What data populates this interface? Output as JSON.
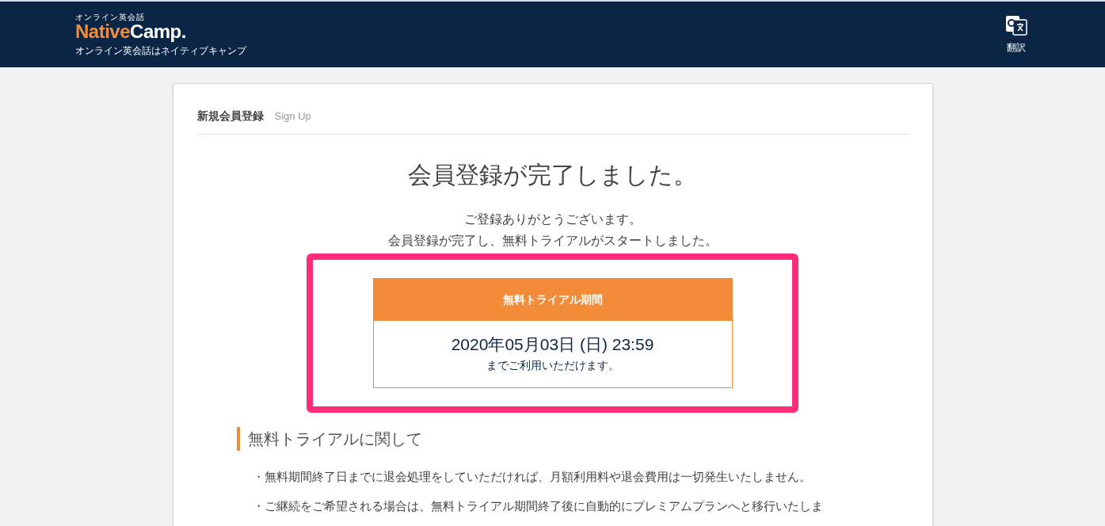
{
  "header": {
    "logo_small": "オンライン英会話",
    "logo_native": "Native",
    "logo_camp": "Camp.",
    "tagline": "オンライン英会話はネイティブキャンプ",
    "translate_label": "翻訳"
  },
  "card": {
    "title": "新規会員登録",
    "subtitle": "Sign Up",
    "heading": "会員登録が完了しました。",
    "messages": [
      "ご登録ありがとうございます。",
      "会員登録が完了し、無料トライアルがスタートしました。"
    ],
    "trial": {
      "label": "無料トライアル期間",
      "date": "2020年05月03日 (日) 23:59",
      "note": "までご利用いただけます。"
    },
    "section_title": "無料トライアルに関して",
    "bullets": [
      "・無料期間終了日までに退会処理をしていただければ、月額利用料や退会費用は一切発生いたしません。",
      "・ご継続をご希望される場合は、無料トライアル期間終了後に自動的にプレミアムプランへと移行いたしま"
    ]
  }
}
